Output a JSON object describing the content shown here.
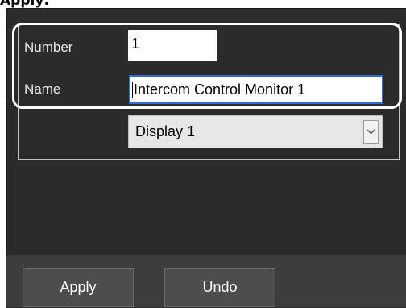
{
  "heading": "Apply:",
  "form": {
    "number_label": "Number",
    "number_value": "1",
    "name_label": "Name",
    "name_value": "Intercom Control Monitor 1",
    "display_value": "Display 1"
  },
  "buttons": {
    "apply_label": "Apply",
    "undo_first_letter": "U",
    "undo_rest": "ndo"
  },
  "colors": {
    "panel_bg": "#2b2b2b",
    "highlight_outline": "#ffffff",
    "focus_border": "#2f6fd0"
  },
  "icons": {
    "dropdown": "chevron-down-icon"
  }
}
